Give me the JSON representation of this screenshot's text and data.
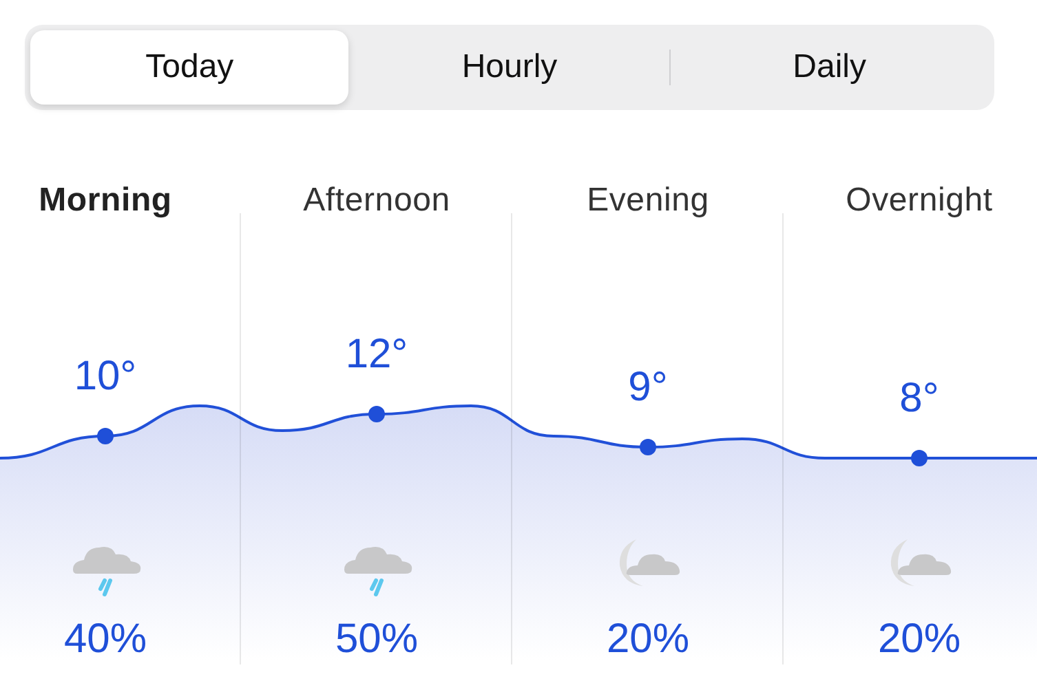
{
  "tabs": [
    {
      "label": "Today",
      "selected": true
    },
    {
      "label": "Hourly",
      "selected": false
    },
    {
      "label": "Daily",
      "selected": false
    }
  ],
  "periods": [
    {
      "name": "Morning",
      "selected": true,
      "temperature": "10°",
      "kind": "rain",
      "precipitation": "40%"
    },
    {
      "name": "Afternoon",
      "selected": false,
      "temperature": "12°",
      "kind": "rain",
      "precipitation": "50%"
    },
    {
      "name": "Evening",
      "selected": false,
      "temperature": "9°",
      "kind": "night",
      "precipitation": "20%"
    },
    {
      "name": "Overnight",
      "selected": false,
      "temperature": "8°",
      "kind": "night",
      "precipitation": "20%"
    }
  ]
}
